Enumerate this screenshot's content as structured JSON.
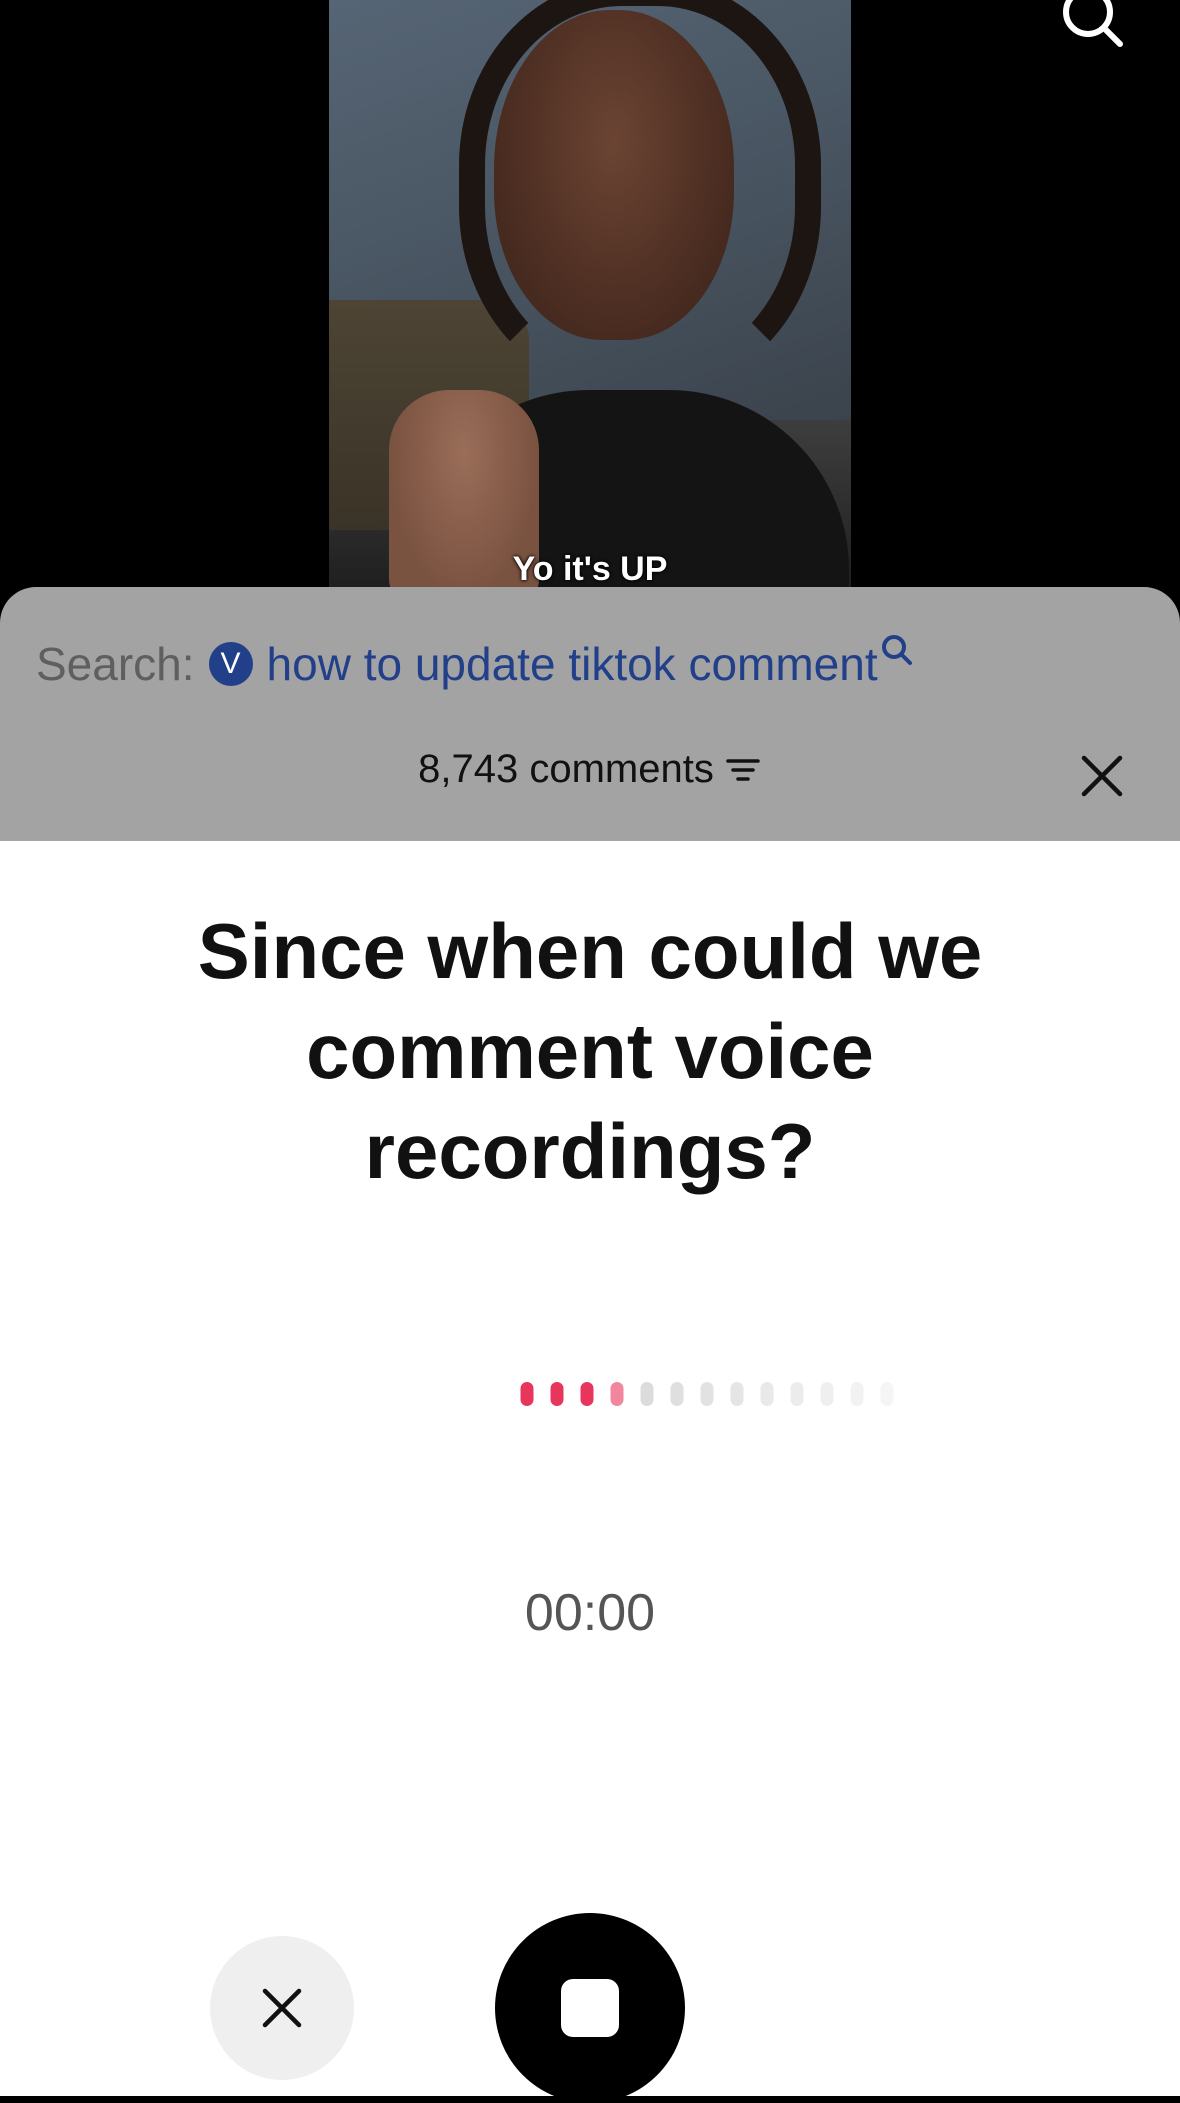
{
  "video": {
    "caption": "Yo it's UP"
  },
  "comments_panel": {
    "search_prefix": "Search:",
    "search_badge": "V",
    "search_query": "how to update tiktok comment",
    "comment_count_label": "8,743 comments"
  },
  "voice_recorder": {
    "title": "Since when could we comment voice recordings?",
    "timer": "00:00",
    "waveform": {
      "dot_count": 13,
      "active_dots": 4,
      "active_color": "#e8355c",
      "inactive_color": "#dcdcdc"
    }
  },
  "icons": {
    "top_right": "search-icon",
    "panel_close": "close-icon",
    "filter": "filter-icon",
    "cancel": "close-icon",
    "stop": "stop-icon"
  }
}
